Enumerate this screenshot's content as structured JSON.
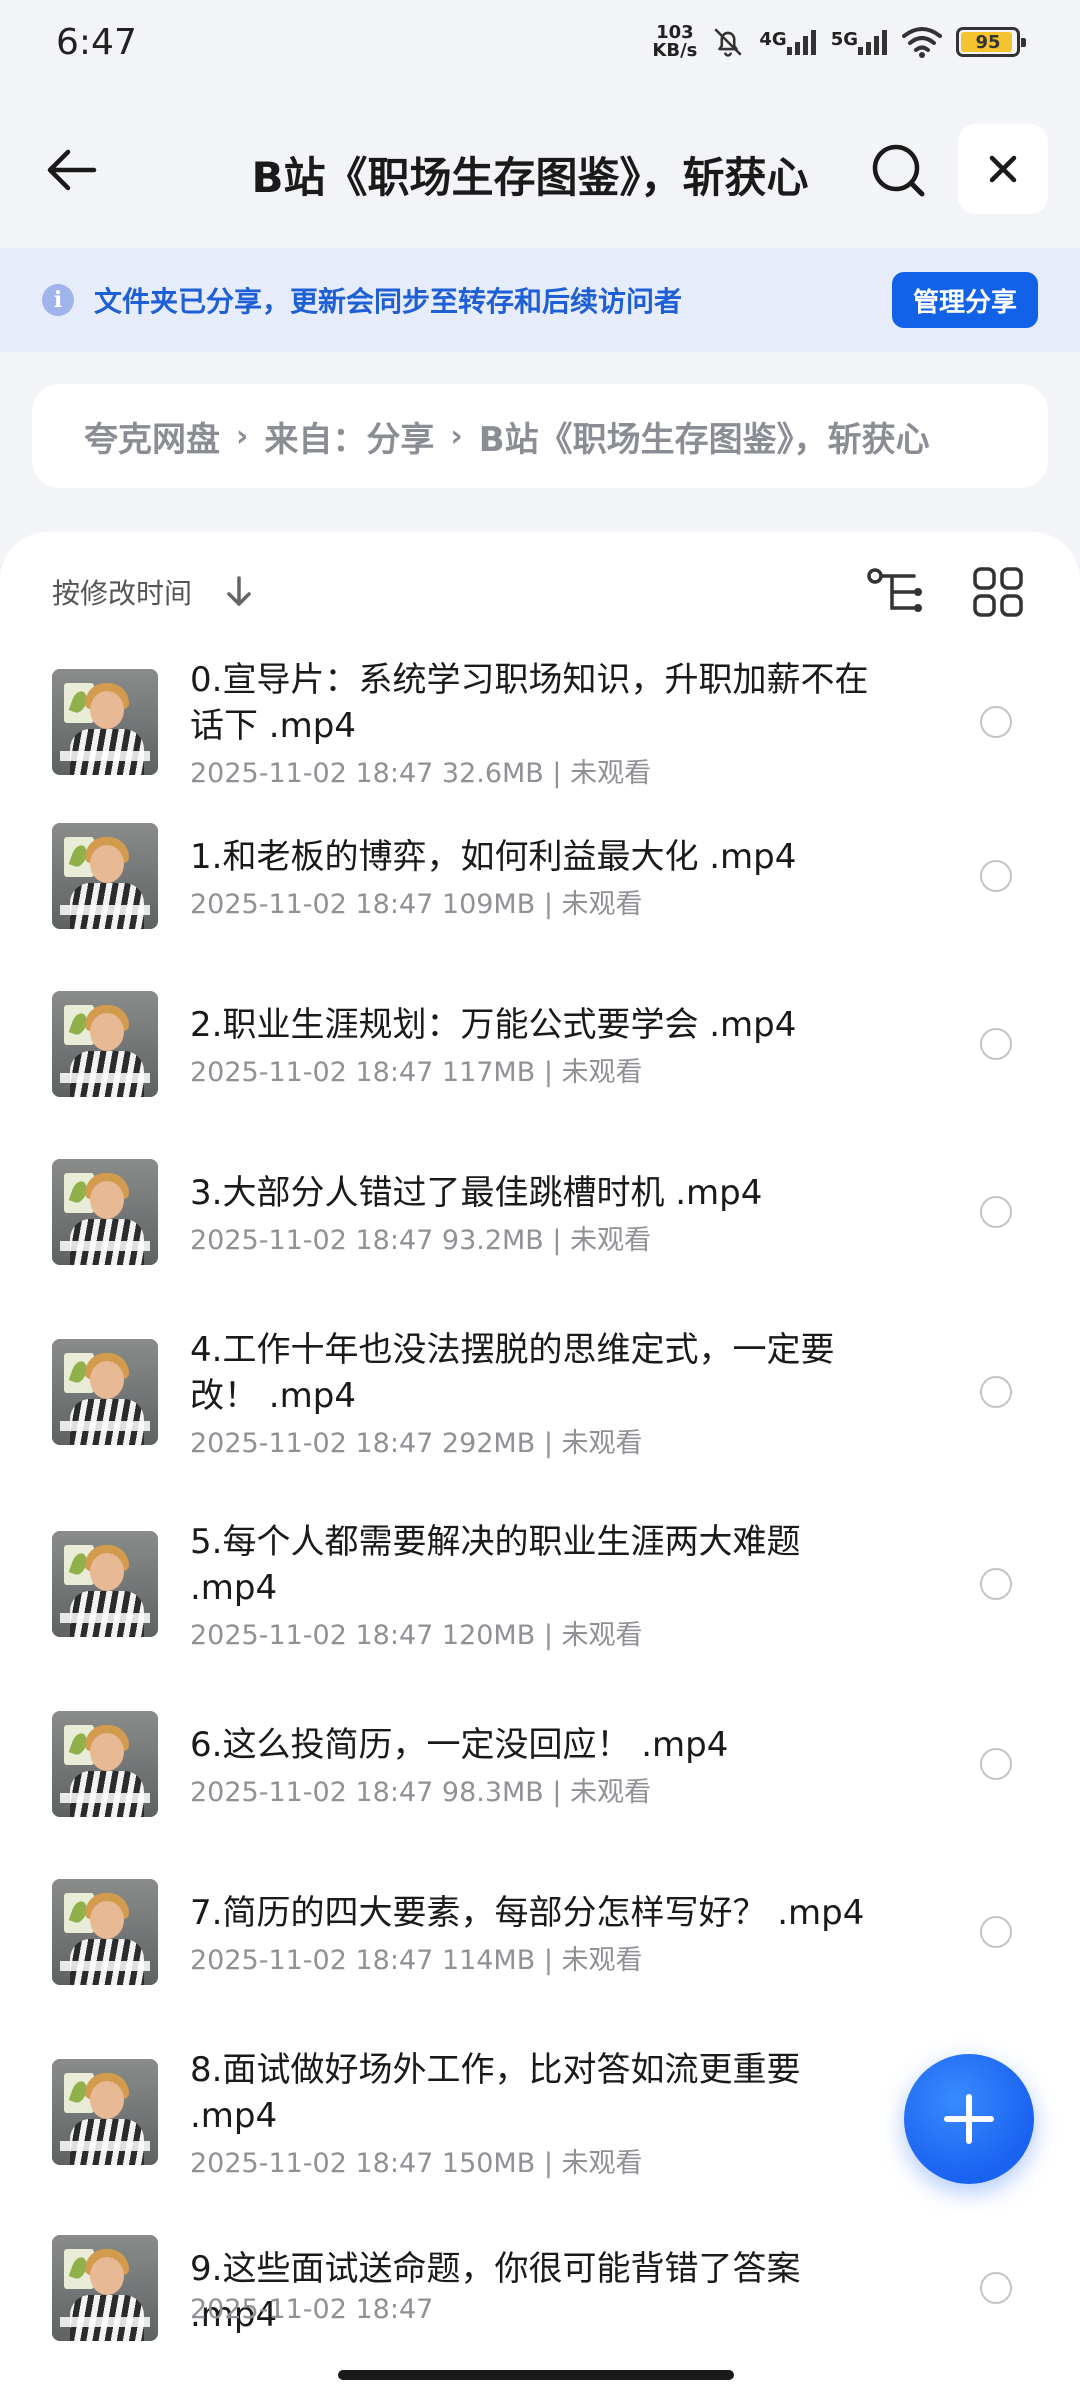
{
  "status_bar": {
    "time": "6:47",
    "net_speed_top": "103",
    "net_speed_bottom": "KB/s",
    "signal_1": "4G",
    "signal_2": "5G",
    "battery": "95",
    "battery_level": 0.95
  },
  "header": {
    "title": "B站《职场生存图鉴》，斩获心"
  },
  "banner": {
    "info_icon": "i",
    "text": "文件夹已分享，更新会同步至转存和后续访问者",
    "manage_label": "管理分享"
  },
  "breadcrumb": {
    "items": [
      "夸克网盘",
      "来自：分享",
      "B站《职场生存图鉴》，斩获心"
    ]
  },
  "sort": {
    "label": "按修改时间"
  },
  "files": [
    {
      "name": "0.宣导片：系统学习职场知识，升职加薪不在话下 .mp4",
      "meta": "2025-11-02 18:47  32.6MB | 未观看"
    },
    {
      "name": "1.和老板的博弈，如何利益最大化 .mp4",
      "meta": "2025-11-02 18:47  109MB | 未观看"
    },
    {
      "name": "2.职业生涯规划：万能公式要学会 .mp4",
      "meta": "2025-11-02 18:47  117MB | 未观看"
    },
    {
      "name": "3.大部分人错过了最佳跳槽时机 .mp4",
      "meta": "2025-11-02 18:47  93.2MB | 未观看"
    },
    {
      "name": "4.工作十年也没法摆脱的思维定式，一定要改！ .mp4",
      "meta": "2025-11-02 18:47  292MB | 未观看"
    },
    {
      "name": "5.每个人都需要解决的职业生涯两大难题 .mp4",
      "meta": "2025-11-02 18:47  120MB | 未观看"
    },
    {
      "name": "6.这么投简历，一定没回应！ .mp4",
      "meta": "2025-11-02 18:47  98.3MB | 未观看"
    },
    {
      "name": "7.简历的四大要素，每部分怎样写好？ .mp4",
      "meta": "2025-11-02 18:47  114MB | 未观看"
    },
    {
      "name": "8.面试做好场外工作，比对答如流更重要 .mp4",
      "meta": "2025-11-02 18:47  150MB | 未观看"
    },
    {
      "name": "9.这些面试送命题，你很可能背错了答案 .mp4",
      "meta": "2025-11-02 18:47"
    }
  ],
  "colors": {
    "accent": "#1262e8",
    "banner_bg": "#e7ecfa",
    "banner_text": "#1e5fd6"
  },
  "icons": {
    "back": "back-arrow-icon",
    "search": "search-icon",
    "close": "close-icon",
    "info": "info-icon",
    "sort": "arrow-down-icon",
    "tree": "tree-view-icon",
    "grid": "grid-view-icon",
    "fab": "plus-icon"
  }
}
